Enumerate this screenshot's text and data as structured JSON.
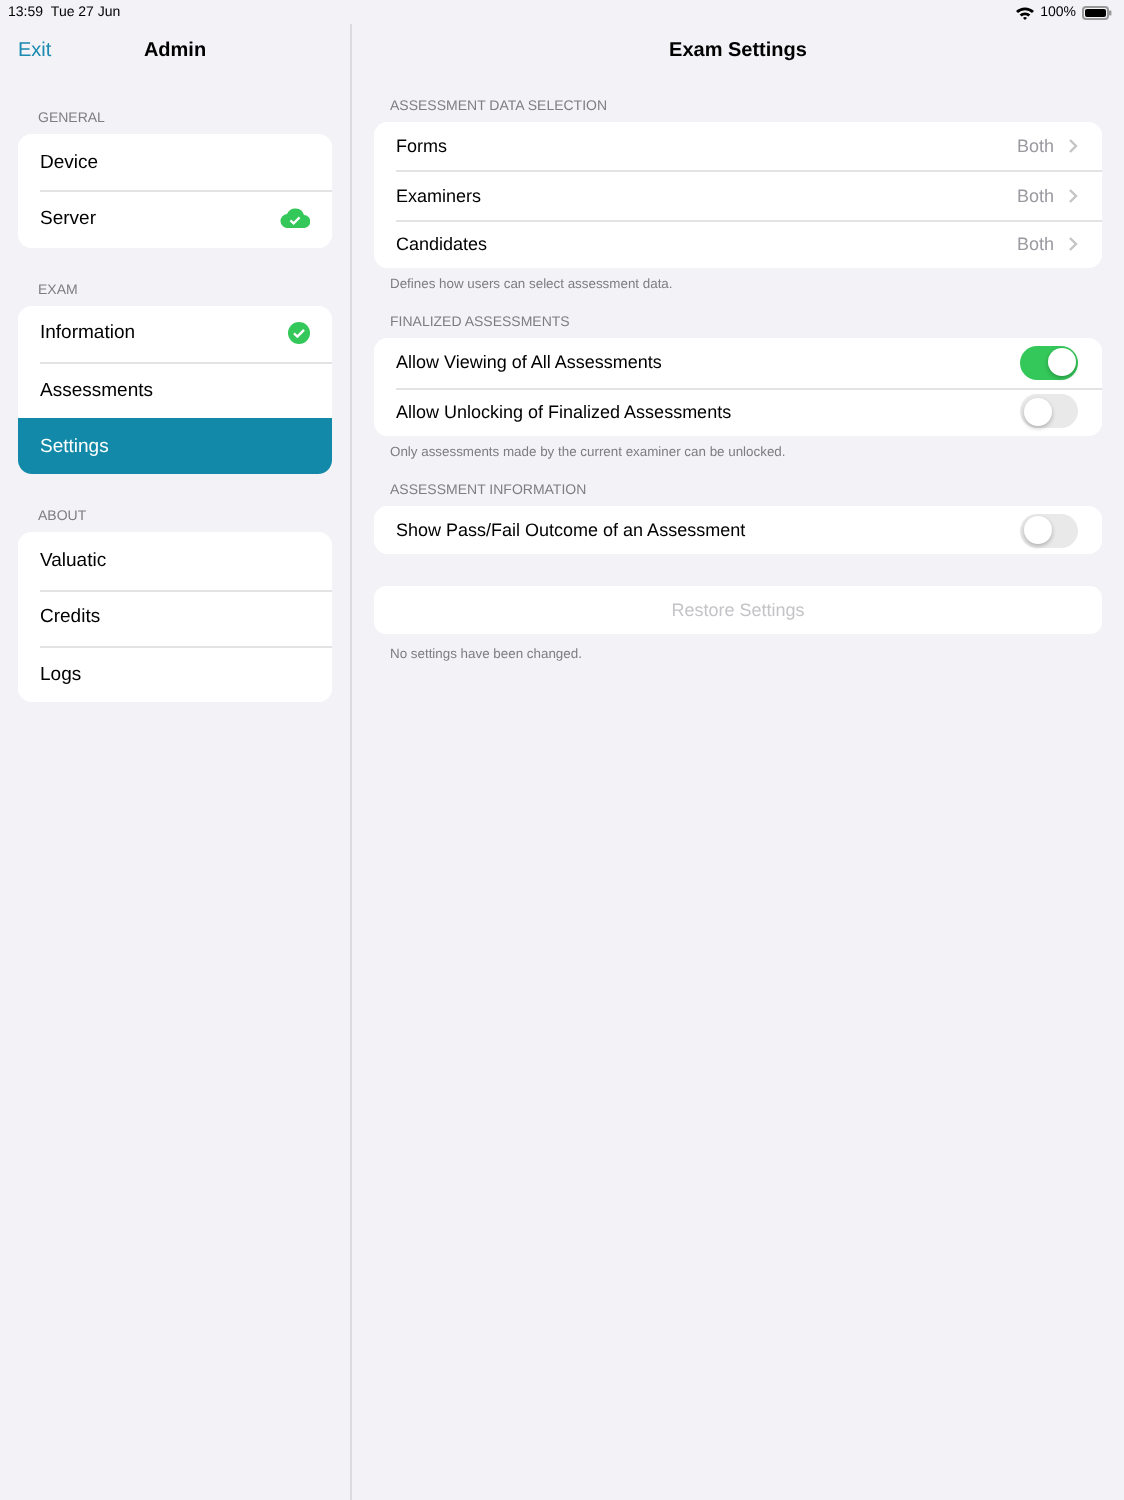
{
  "status_bar": {
    "time": "13:59",
    "date": "Tue 27 Jun",
    "battery": "100%"
  },
  "sidebar": {
    "back": "Exit",
    "title": "Admin",
    "sections": [
      {
        "header": "GENERAL",
        "items": [
          {
            "kind": "plain",
            "label": "Device",
            "selected": false
          },
          {
            "kind": "synced",
            "label": "Server",
            "selected": false
          }
        ]
      },
      {
        "header": "EXAM",
        "items": [
          {
            "kind": "done",
            "label": "Information",
            "selected": false
          },
          {
            "kind": "plain",
            "label": "Assessments",
            "selected": false
          },
          {
            "kind": "plain",
            "label": "Settings",
            "selected": true
          }
        ]
      },
      {
        "header": "ABOUT",
        "items": [
          {
            "kind": "plain",
            "label": "Valuatic",
            "selected": false
          },
          {
            "kind": "plain",
            "label": "Credits",
            "selected": false
          },
          {
            "kind": "plain",
            "label": "Logs",
            "selected": false
          }
        ]
      }
    ]
  },
  "main": {
    "title": "Exam Settings",
    "groups": [
      {
        "header": "ASSESSMENT DATA SELECTION",
        "rows": [
          {
            "kind": "disclosure",
            "label": "Forms",
            "value": "Both"
          },
          {
            "kind": "disclosure",
            "label": "Examiners",
            "value": "Both"
          },
          {
            "kind": "disclosure",
            "label": "Candidates",
            "value": "Both"
          }
        ],
        "footer": "Defines how users can select assessment data."
      },
      {
        "header": "FINALIZED ASSESSMENTS",
        "rows": [
          {
            "kind": "toggle",
            "label": "Allow Viewing of All Assessments",
            "on": true
          },
          {
            "kind": "toggle",
            "label": "Allow Unlocking of Finalized Assessments",
            "on": false
          }
        ],
        "footer": "Only assessments made by the current examiner can be unlocked."
      },
      {
        "header": "ASSESSMENT INFORMATION",
        "rows": [
          {
            "kind": "toggle",
            "label": "Show Pass/Fail Outcome of an Assessment",
            "on": false
          }
        ]
      }
    ],
    "restore": {
      "label": "Restore Settings",
      "disabled": true,
      "footer": "No settings have been changed."
    }
  }
}
